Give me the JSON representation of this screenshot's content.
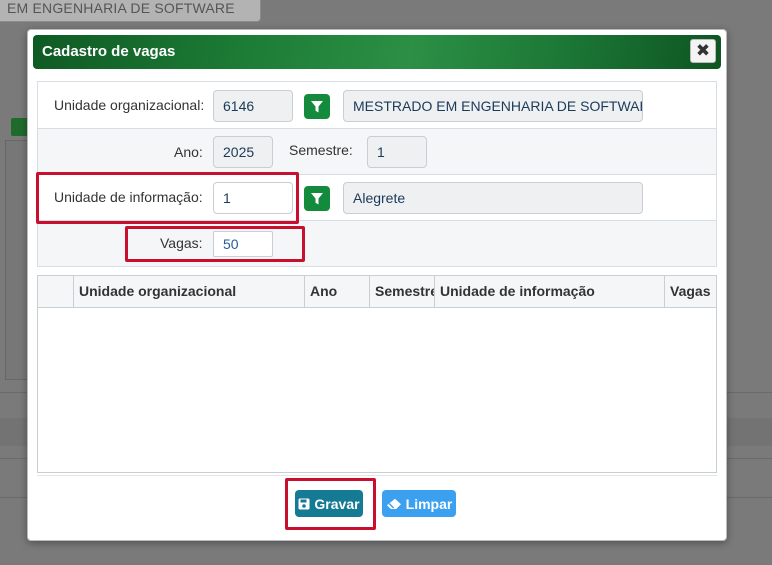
{
  "background": {
    "tab_label": "EM ENGENHARIA DE SOFTWARE"
  },
  "modal": {
    "title": "Cadastro de vagas",
    "close_icon": "close-icon"
  },
  "form": {
    "unidade_org": {
      "label": "Unidade organizacional:",
      "code": "6146",
      "name": "MESTRADO EM ENGENHARIA DE SOFTWARE"
    },
    "ano": {
      "label": "Ano:",
      "value": "2025"
    },
    "semestre": {
      "label": "Semestre:",
      "value": "1"
    },
    "unidade_info": {
      "label": "Unidade de informação:",
      "code": "1",
      "name": "Alegrete"
    },
    "vagas": {
      "label": "Vagas:",
      "value": "50"
    }
  },
  "grid": {
    "columns": [
      "Unidade organizacional",
      "Ano",
      "Semestre",
      "Unidade de informação",
      "Vagas"
    ],
    "rows": []
  },
  "actions": {
    "save_label": "Gravar",
    "clear_label": "Limpar"
  },
  "colors": {
    "header_green": "#1c7b35",
    "filter_green": "#138a3c",
    "save_blue": "#157a94",
    "clear_blue": "#3ba0ef",
    "highlight_red": "#c8102e"
  }
}
